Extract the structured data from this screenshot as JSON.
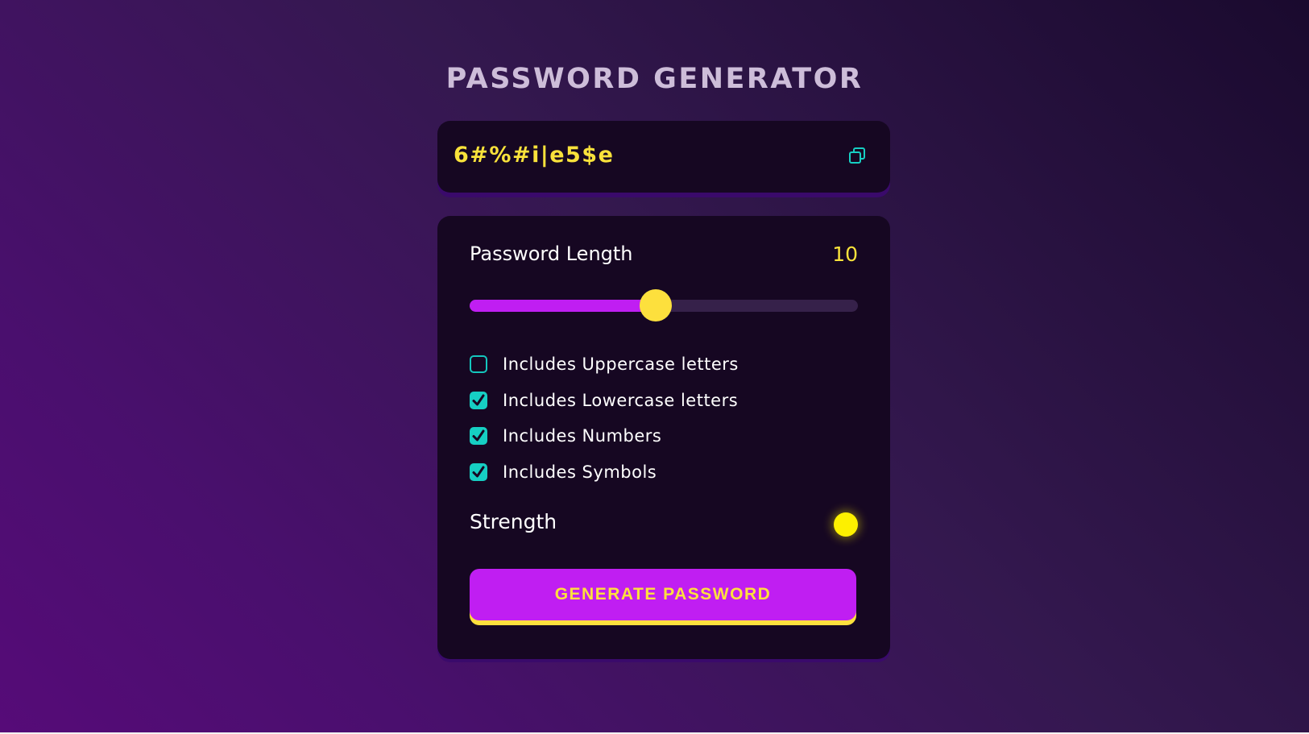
{
  "title": "PASSWORD GENERATOR",
  "password": {
    "value": "6#%#i|e5$e",
    "copy_icon": "copy-icon"
  },
  "length": {
    "label": "Password Length",
    "value": "10",
    "slider_fraction": 0.48
  },
  "options": [
    {
      "label": "Includes Uppercase letters",
      "checked": false
    },
    {
      "label": "Includes Lowercase letters",
      "checked": true
    },
    {
      "label": "Includes Numbers",
      "checked": true
    },
    {
      "label": "Includes Symbols",
      "checked": true
    }
  ],
  "strength": {
    "label": "Strength",
    "indicator_color": "#fdf000"
  },
  "generate_button": {
    "label": "GENERATE PASSWORD"
  },
  "colors": {
    "accent_purple": "#c01ef2",
    "accent_yellow": "#fde03d",
    "checkbox_teal": "#16cfc3",
    "panel_bg": "#160722"
  }
}
